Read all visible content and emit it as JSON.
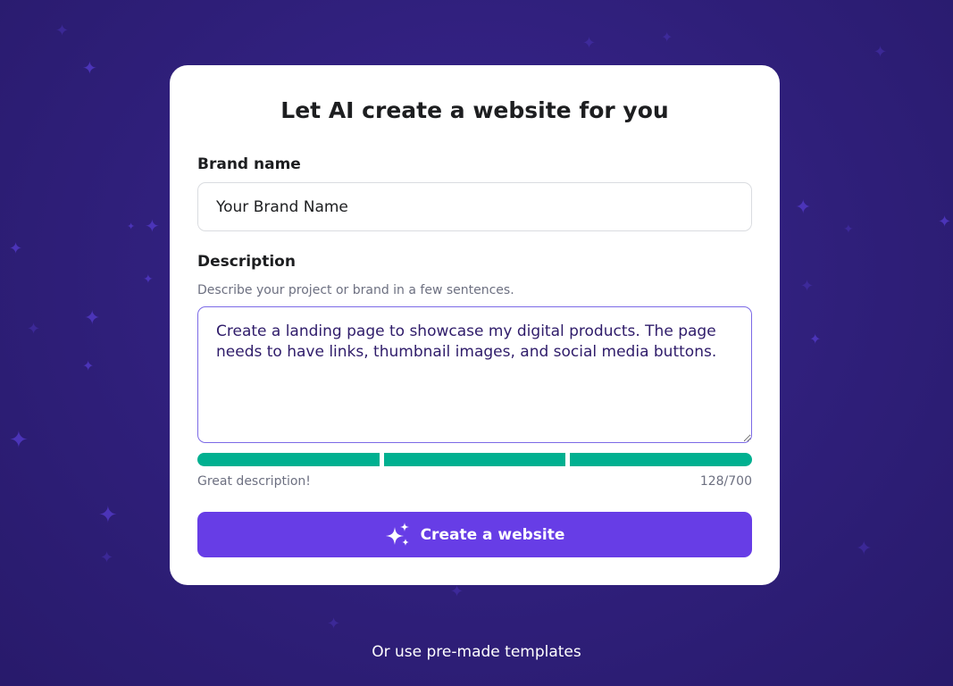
{
  "card": {
    "title": "Let AI create a website for you"
  },
  "brand": {
    "label": "Brand name",
    "value": "Your Brand Name"
  },
  "description": {
    "label": "Description",
    "hint": "Describe your project or brand in a few sentences.",
    "value": "Create a landing page to showcase my digital products. The page needs to have links, thumbnail images, and social media buttons."
  },
  "quality": {
    "message": "Great description!",
    "counter": "128/700",
    "filled_segments": 3,
    "total_segments": 3,
    "color": "#00b090"
  },
  "actions": {
    "create_label": "Create a website",
    "create_icon": "sparkles-icon",
    "create_color": "#673de6",
    "templates_link": "Or use pre-made templates"
  },
  "theme": {
    "background": "#2f1f7a",
    "card_background": "#ffffff",
    "text_primary": "#1d1e20",
    "text_muted": "#6d7081"
  }
}
